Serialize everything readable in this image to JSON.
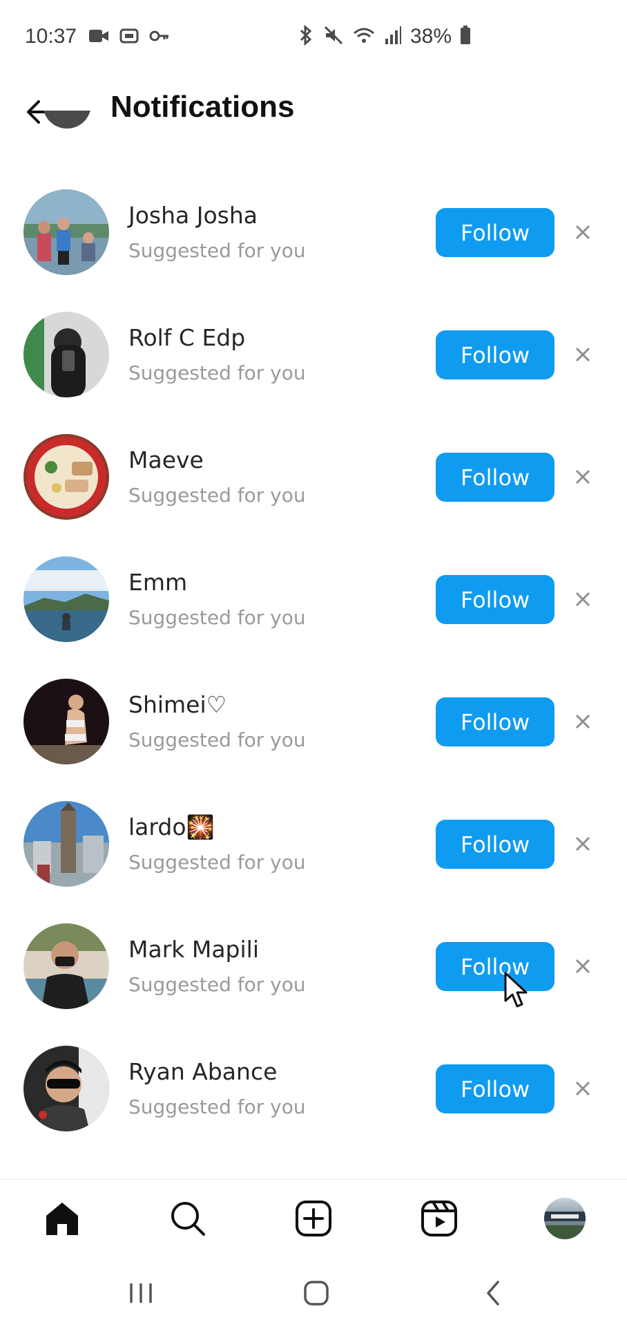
{
  "status_bar": {
    "time": "10:37",
    "battery": "38%",
    "left_icons": [
      "video-icon",
      "cast-icon",
      "key-icon"
    ],
    "right_icons": [
      "bluetooth-icon",
      "mute-icon",
      "wifi-icon",
      "signal-icon",
      "battery-icon"
    ]
  },
  "header": {
    "title": "Notifications",
    "back_icon": "arrow-left-icon"
  },
  "suggestions": [
    {
      "name": "Josha Josha",
      "subtitle": "Suggested for you",
      "button": "Follow",
      "avatar": "family-photo"
    },
    {
      "name": "Rolf C Edp",
      "subtitle": "Suggested for you",
      "button": "Follow",
      "avatar": "mirror-selfie"
    },
    {
      "name": "Maeve",
      "subtitle": "Suggested for you",
      "button": "Follow",
      "avatar": "ramen-bowl"
    },
    {
      "name": "Emm",
      "subtitle": "Suggested for you",
      "button": "Follow",
      "avatar": "beach-sky"
    },
    {
      "name": "Shimei♡",
      "subtitle": "Suggested for you",
      "button": "Follow",
      "avatar": "night-portrait"
    },
    {
      "name": "lardo🎇",
      "subtitle": "Suggested for you",
      "button": "Follow",
      "avatar": "clock-tower"
    },
    {
      "name": "Mark Mapili",
      "subtitle": "Suggested for you",
      "button": "Follow",
      "avatar": "masked-man"
    },
    {
      "name": "Ryan Abance",
      "subtitle": "Suggested for you",
      "button": "Follow",
      "avatar": "sunglasses-man"
    }
  ],
  "bottom_nav": [
    "home-icon",
    "search-icon",
    "create-icon",
    "reels-icon",
    "profile-avatar"
  ],
  "system_nav": [
    "recents-icon",
    "home-button-icon",
    "back-icon"
  ],
  "colors": {
    "follow_button": "#0f9bf0",
    "subtitle": "#9a9a9a"
  }
}
